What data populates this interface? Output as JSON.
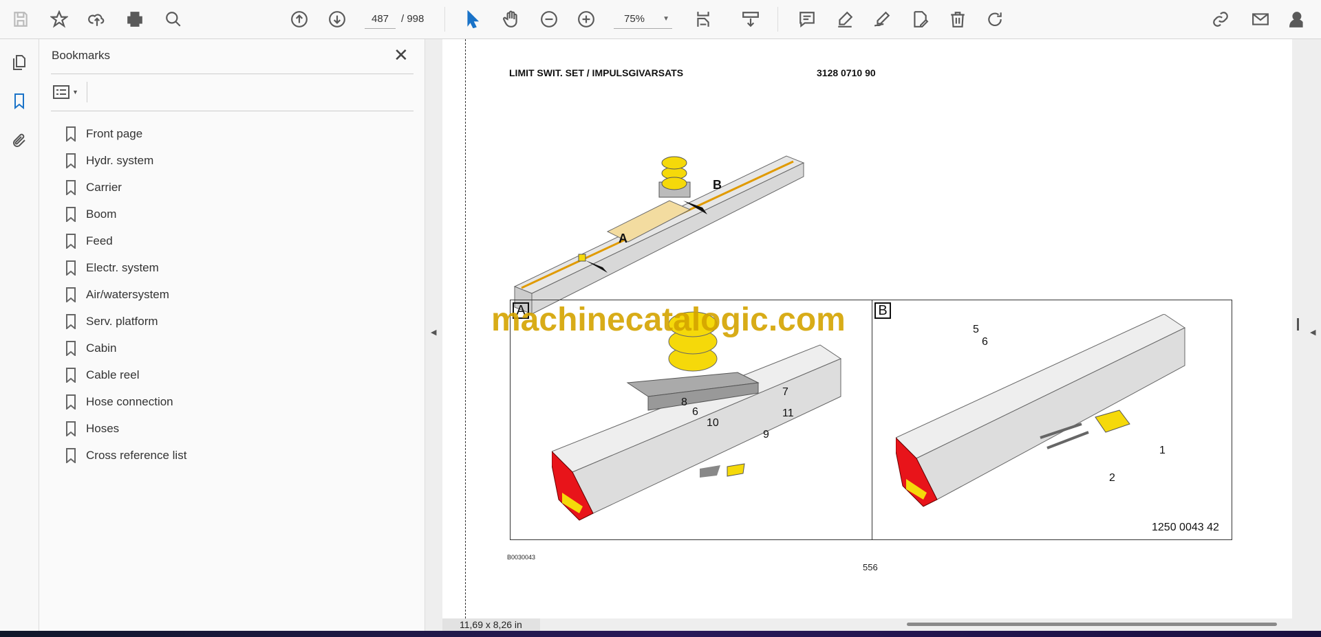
{
  "toolbar": {
    "icons": [
      "save-icon",
      "bookmark-star-icon",
      "upload-cloud-icon",
      "print-icon",
      "search-zoom-icon",
      "page-up-icon",
      "page-down-icon",
      "select-arrow-icon",
      "hand-icon",
      "zoom-out-icon",
      "zoom-in-icon",
      "fit-page-icon",
      "scroll-mode-icon",
      "comment-icon",
      "highlight-icon",
      "sign-icon",
      "edit-pdf-icon",
      "delete-icon",
      "rotate-icon",
      "share-link-icon",
      "email-icon",
      "account-icon"
    ],
    "page_current": "487",
    "page_total": "/ 998",
    "zoom": "75%"
  },
  "panel": {
    "title": "Bookmarks",
    "bookmarks": [
      "Front page",
      "Hydr. system",
      "Carrier",
      "Boom",
      "Feed",
      "Electr. system",
      "Air/watersystem",
      "Serv. platform",
      "Cabin",
      "Cable reel",
      "Hose connection",
      "Hoses",
      "Cross reference list"
    ]
  },
  "page": {
    "title": "LIMIT SWIT. SET / IMPULSGIVARSATS",
    "part_number": "3128 0710 90",
    "overview_labels": [
      "A",
      "B"
    ],
    "box_a_label": "A",
    "box_b_label": "B",
    "callouts_a": [
      "7",
      "8",
      "6",
      "11",
      "10",
      "9"
    ],
    "callouts_b": [
      "5",
      "6",
      "1",
      "2"
    ],
    "drawing_number": "1250 0043 42",
    "figure_code": "B0030043",
    "page_number": "556",
    "watermark": "machinecatalogic.com"
  },
  "status": {
    "dimensions": "11,69 x 8,26 in"
  },
  "colors": {
    "accent": "#1a73c8",
    "yellow": "#f5d90a",
    "red": "#e8141a"
  }
}
